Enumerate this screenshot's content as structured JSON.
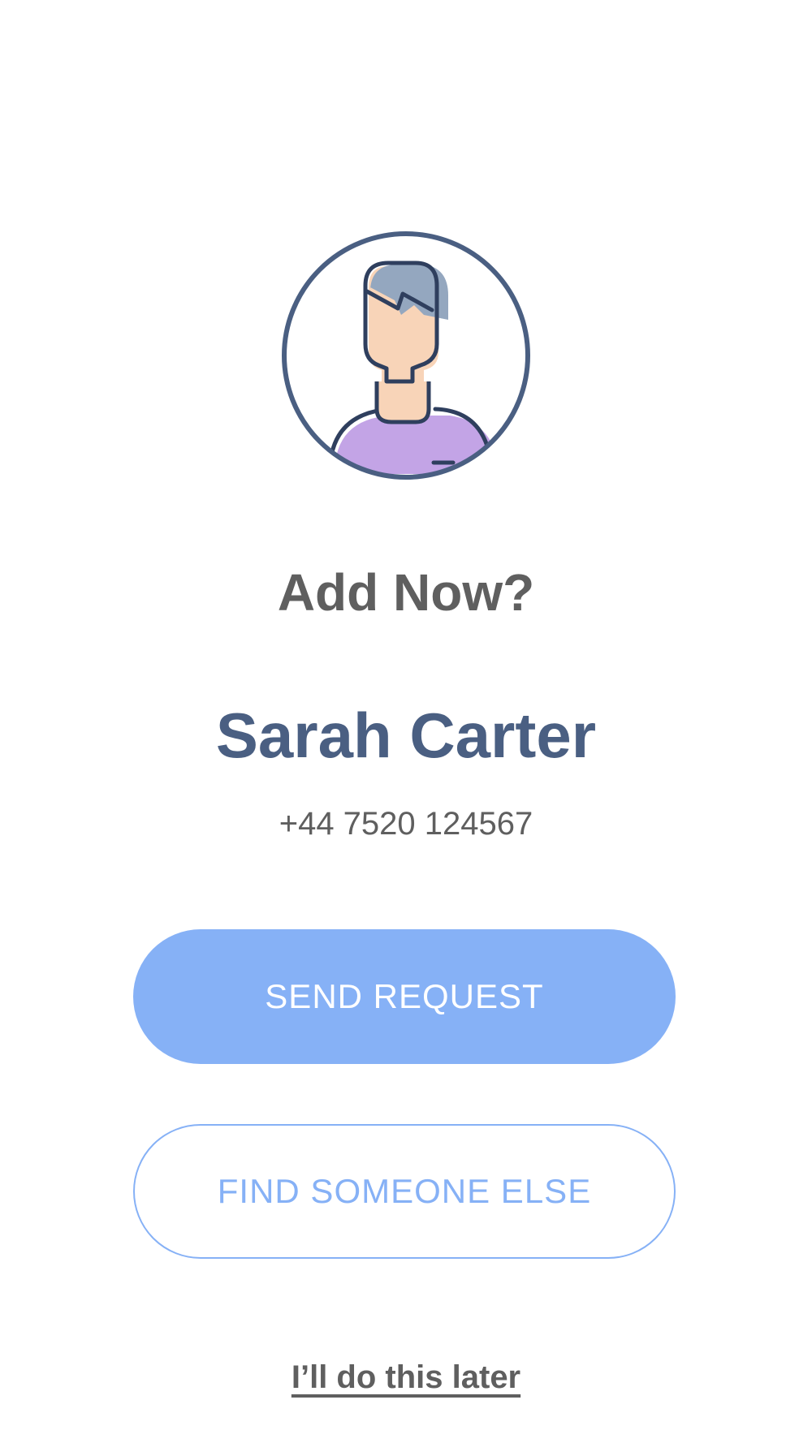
{
  "prompt": {
    "title": "Add Now?"
  },
  "contact": {
    "name": "Sarah Carter",
    "phone": "+44 7520 124567",
    "avatar_icon": "user-avatar-icon"
  },
  "actions": {
    "send_request_label": "SEND REQUEST",
    "find_someone_else_label": "FIND SOMEONE ELSE",
    "later_label": "I’ll do this later"
  },
  "colors": {
    "accent": "#86b1f6",
    "name_text": "#4a5f82",
    "body_text": "#5f5f5f",
    "avatar_outline": "#4a5f82",
    "avatar_hair": "#94a7bf",
    "avatar_skin": "#f8d4b8",
    "avatar_shirt": "#c3a4e6"
  }
}
